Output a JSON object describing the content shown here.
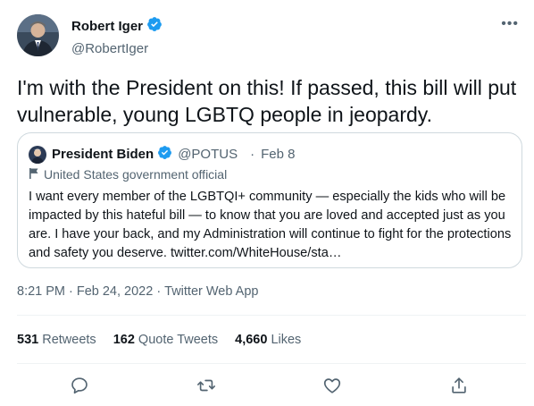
{
  "author": {
    "name": "Robert Iger",
    "handle": "@RobertIger",
    "verified": true,
    "avatar_icon": "person-avatar"
  },
  "more_label": "•••",
  "tweet": {
    "text": "I'm with the President on this! If passed, this bill will put vulnerable, young LGBTQ people in jeopardy."
  },
  "quote": {
    "name": "President Biden",
    "handle": "@POTUS",
    "separator": "·",
    "date": "Feb 8",
    "label": "United States government official",
    "text": "I want every member of the LGBTQI+ community — especially the kids who will be impacted by this hateful bill — to know that you are loved and accepted just as you are. I have your back, and my Administration will continue to fight for the protections and safety you deserve. twitter.com/WhiteHouse/sta…"
  },
  "meta": {
    "time": "8:21 PM",
    "sep1": "·",
    "date": "Feb 24, 2022",
    "sep2": "·",
    "source": "Twitter Web App"
  },
  "stats": {
    "retweets_count": "531",
    "retweets_label": "Retweets",
    "quotes_count": "162",
    "quotes_label": "Quote Tweets",
    "likes_count": "4,660",
    "likes_label": "Likes"
  },
  "colors": {
    "verified_blue": "#1d9bf0",
    "text": "#0f1419",
    "muted": "#536471",
    "border": "#cfd9de"
  }
}
